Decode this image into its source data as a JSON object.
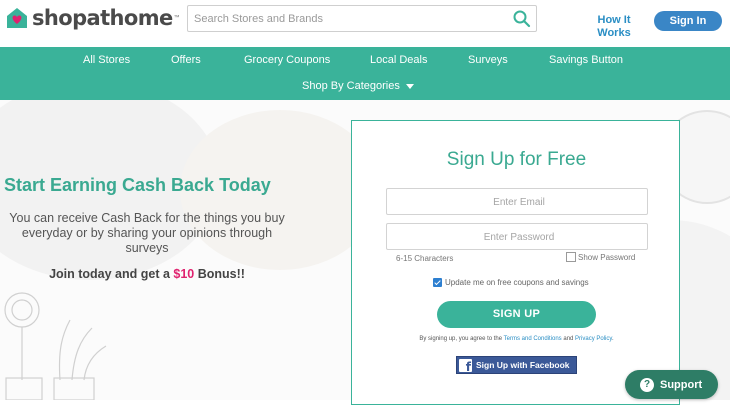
{
  "header": {
    "logo_text": "shopathome",
    "logo_tm": "™",
    "search_placeholder": "Search Stores and Brands",
    "how_it_works": "How It Works",
    "sign_in": "Sign In"
  },
  "nav": {
    "row1": [
      "All Stores",
      "Offers",
      "Grocery Coupons",
      "Local Deals",
      "Surveys",
      "Savings Button"
    ],
    "shop_by_categories": "Shop By Categories"
  },
  "hero": {
    "headline": "Start Earning Cash Back Today",
    "subtext": "You can receive Cash Back for the things you buy everyday or by sharing your opinions through surveys",
    "bonus_prefix": "Join today and get a ",
    "bonus_amount": "$10",
    "bonus_suffix": " Bonus!!"
  },
  "signup": {
    "title": "Sign Up for Free",
    "email_placeholder": "Enter Email",
    "password_placeholder": "Enter Password",
    "password_hint": "6-15 Characters",
    "show_password": "Show Password",
    "update_label": "Update me on free coupons and savings",
    "update_checked": true,
    "signup_button": "SIGN UP",
    "legal_prefix": "By signing up, you agree to the ",
    "terms_link": "Terms and Conditions",
    "legal_and": " and ",
    "privacy_link": "Privacy Policy",
    "legal_suffix": ".",
    "facebook_button": "Sign Up with Facebook"
  },
  "support": {
    "label": "Support"
  },
  "colors": {
    "brand_green": "#3ab39a",
    "link_blue": "#2a8ec4",
    "bonus_pink": "#e0226f",
    "facebook_blue": "#3b5998",
    "support_green": "#2e7d66"
  }
}
